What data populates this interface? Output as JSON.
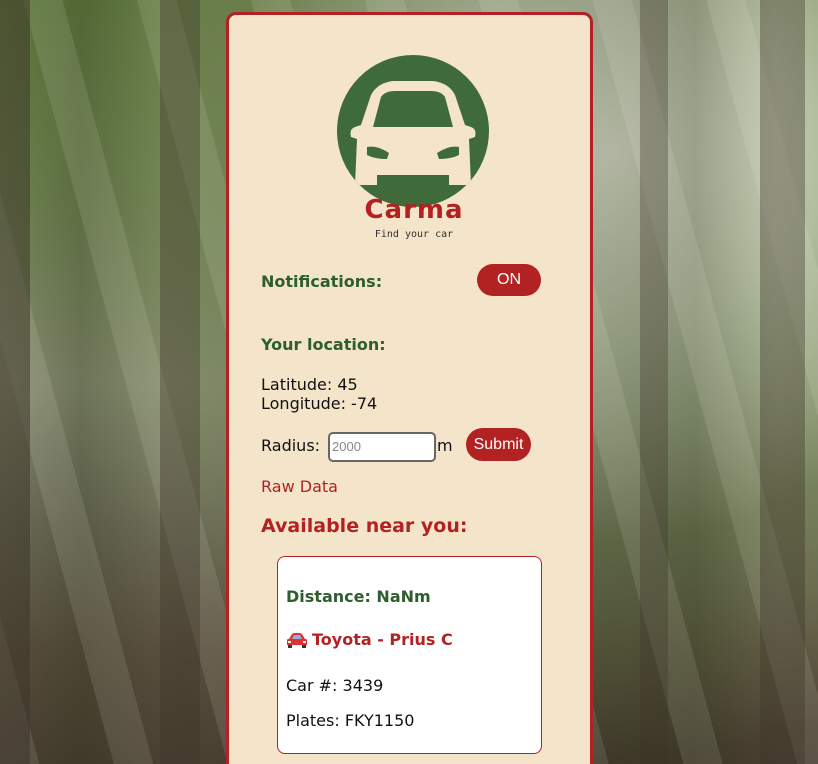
{
  "app": {
    "brand": "Carma",
    "tagline": "Find your car"
  },
  "notifications": {
    "label": "Notifications:",
    "toggle_label": "ON"
  },
  "location": {
    "heading": "Your location:",
    "latitude_label": "Latitude: 45",
    "longitude_label": "Longitude: -74"
  },
  "radius": {
    "label": "Radius:",
    "input_value": "2000",
    "unit": "m",
    "submit_label": "Submit"
  },
  "raw_data_link": "Raw Data",
  "results": {
    "heading": "Available near you:",
    "items": [
      {
        "distance": "Distance: NaNm",
        "car_name": "Toyota - Prius C",
        "car_number": "Car #: 3439",
        "plates": "Plates: FKY1150",
        "icon": "car-icon"
      }
    ]
  },
  "colors": {
    "accent_red": "#b22222",
    "brand_green": "#3f6b3a",
    "card_bg": "#f3e4ca"
  }
}
